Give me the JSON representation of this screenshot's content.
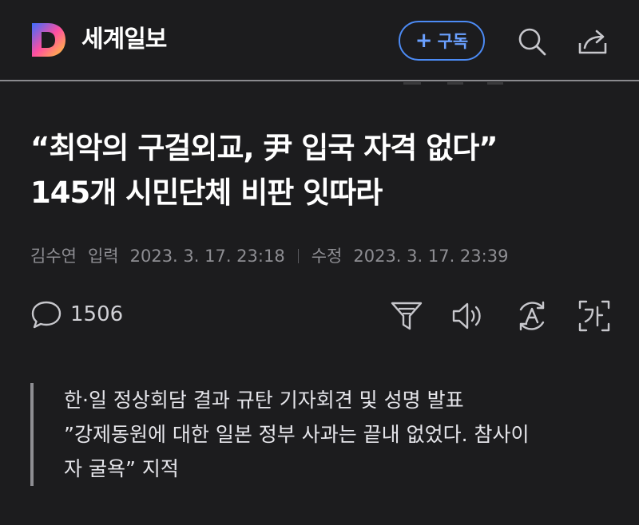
{
  "header": {
    "logo_letter": "D",
    "brand": "세계일보",
    "subscribe_plus": "+",
    "subscribe_label": "구독"
  },
  "article": {
    "title_line1": "“최악의 구걸외교, 尹 입국 자격 없다”",
    "title_line2": "145개 시민단체 비판 잇따라",
    "author": "김수연",
    "published_label": "입력",
    "published": "2023. 3. 17. 23:18",
    "modified_label": "수정",
    "modified": "2023. 3. 17. 23:39",
    "comment_count": "1506",
    "summary": [
      "한·일 정상회담 결과 규탄 기자회견 및 성명 발표",
      "”강제동원에 대한 일본 정부 사과는 끝내 없었다. 참사이",
      "자 굴욕” 지적"
    ]
  },
  "icons": {
    "header": [
      "search-icon",
      "share-icon"
    ],
    "toolbar": [
      "comment-icon",
      "filter-icon",
      "speaker-icon",
      "translate-icon",
      "font-size-icon"
    ]
  },
  "colors": {
    "background": "#1c1c1e",
    "accent": "#4c8bf5",
    "muted": "#8e8e93"
  }
}
